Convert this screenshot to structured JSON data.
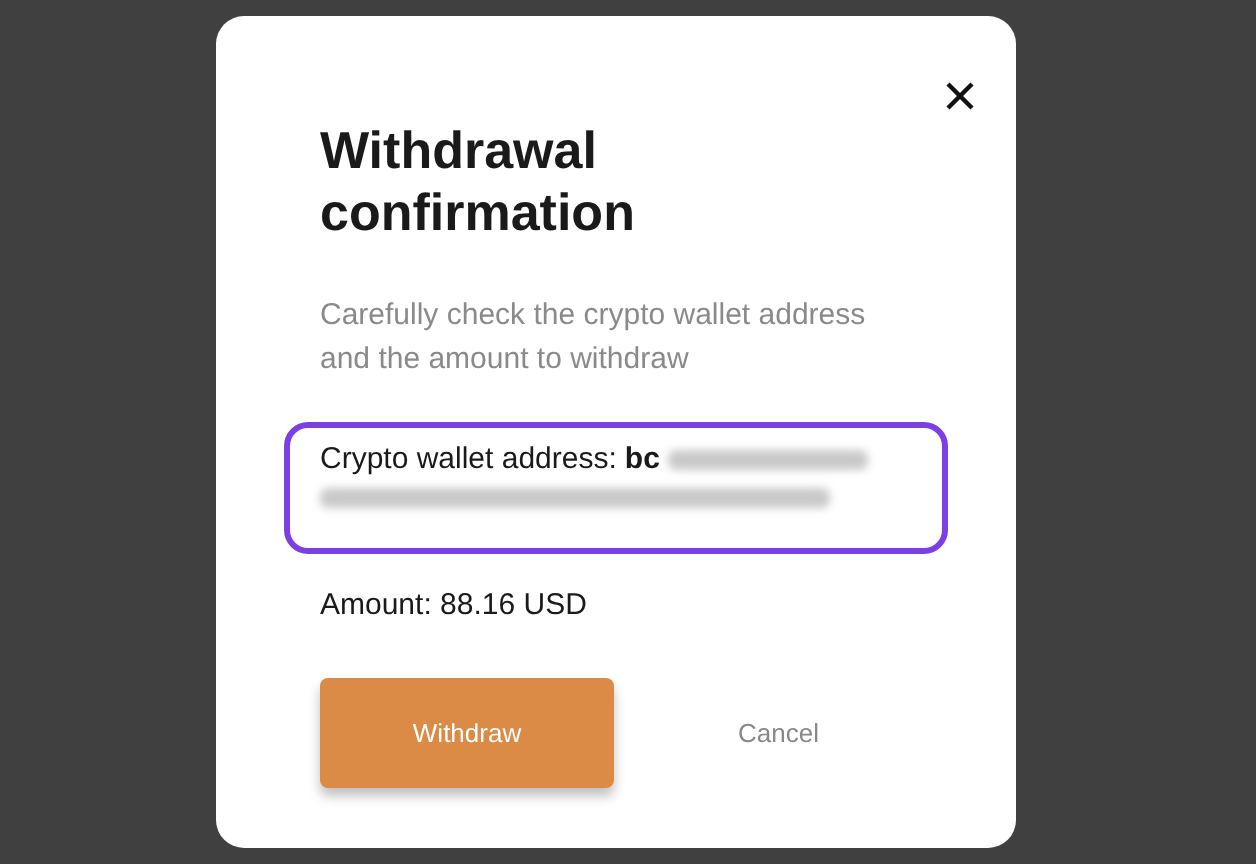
{
  "dialog": {
    "title": "Withdrawal confirmation",
    "description": "Carefully check the crypto wallet address and the amount to withdraw",
    "address_label": "Crypto wallet address:",
    "address_prefix": "bc",
    "address_blurred": true,
    "amount": "Amount: 88.16 USD",
    "buttons": [
      {
        "kind": "primary",
        "label": "Withdraw"
      },
      {
        "kind": "secondary",
        "label": "Cancel"
      }
    ]
  }
}
